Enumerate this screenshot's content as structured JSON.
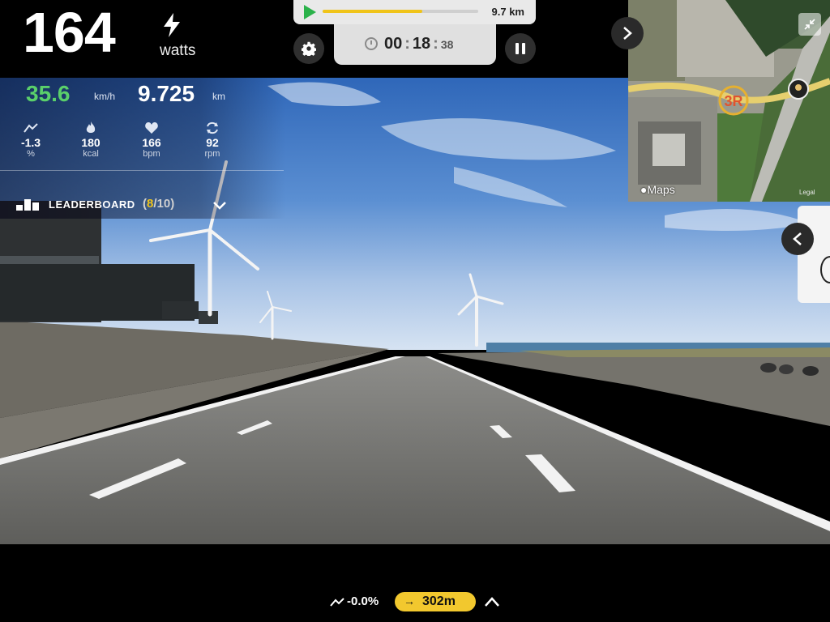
{
  "power": {
    "value": "164",
    "unit": "watts",
    "icon": "bolt-icon"
  },
  "route": {
    "total_distance": "9.7 km",
    "progress_fraction": 0.64
  },
  "timer": {
    "hours": "00",
    "minutes": "18",
    "seconds": "38"
  },
  "stats": {
    "speed": {
      "value": "35.6",
      "unit": "km/h"
    },
    "distance": {
      "value": "9.725",
      "unit": "km"
    },
    "items": [
      {
        "icon": "gradient-icon",
        "value": "-1.3",
        "unit": "%"
      },
      {
        "icon": "flame-icon",
        "value": "180",
        "unit": "kcal"
      },
      {
        "icon": "heart-icon",
        "value": "166",
        "unit": "bpm"
      },
      {
        "icon": "cadence-icon",
        "value": "92",
        "unit": "rpm"
      }
    ]
  },
  "leaderboard": {
    "label": "LEADERBOARD",
    "open": "(",
    "current": "8",
    "sep": "/",
    "total": "10",
    "close": ")"
  },
  "map": {
    "logo": "Maps",
    "legal": "Legal",
    "marker": "3R"
  },
  "bottom": {
    "grade": "-0.0%",
    "next_distance": "302m"
  },
  "colors": {
    "accent": "#f0c419",
    "speed": "#5ad06a",
    "play": "#2bb24a"
  }
}
